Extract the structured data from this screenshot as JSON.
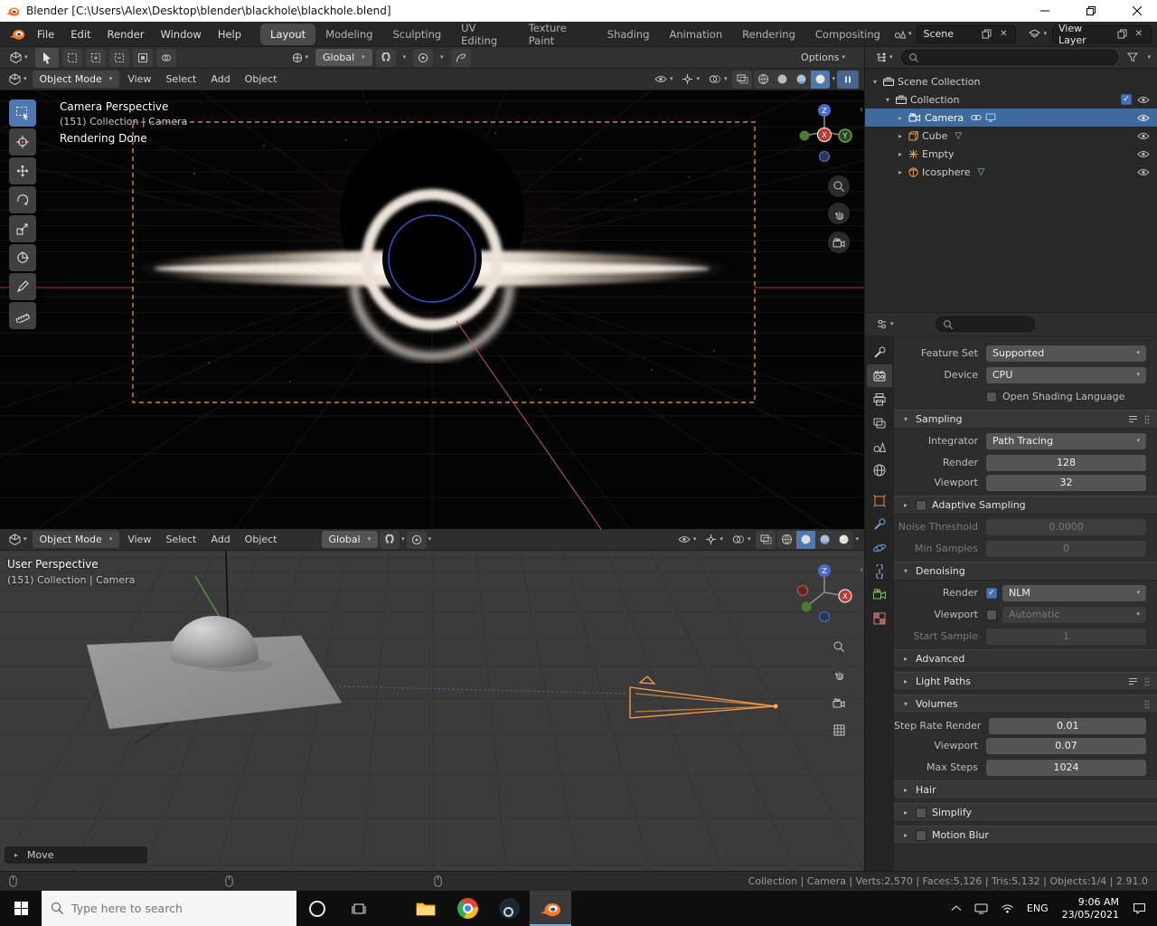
{
  "titlebar": {
    "title": "Blender [C:\\Users\\Alex\\Desktop\\blender\\blackhole\\blackhole.blend]"
  },
  "topbar": {
    "menus": [
      "File",
      "Edit",
      "Render",
      "Window",
      "Help"
    ],
    "workspaces": [
      "Layout",
      "Modeling",
      "Sculpting",
      "UV Editing",
      "Texture Paint",
      "Shading",
      "Animation",
      "Rendering",
      "Compositing"
    ],
    "scene_name": "Scene",
    "view_layer_name": "View Layer"
  },
  "toolrow": {
    "orientation": "Global",
    "options": "Options"
  },
  "viewport_top": {
    "mode": "Object Mode",
    "menus": [
      "View",
      "Select",
      "Add",
      "Object"
    ],
    "overlay_line1": "Camera Perspective",
    "overlay_line2": "(151) Collection | Camera",
    "overlay_line3": "Rendering Done"
  },
  "viewport_bottom": {
    "mode": "Object Mode",
    "menus": [
      "View",
      "Select",
      "Add",
      "Object"
    ],
    "orientation": "Global",
    "overlay_line1": "User Perspective",
    "overlay_line2": "(151) Collection | Camera",
    "move_panel": "Move"
  },
  "gizmo": {
    "x": "X",
    "y": "Y",
    "z": "Z"
  },
  "outliner": {
    "items": [
      {
        "label": "Scene Collection"
      },
      {
        "label": "Collection"
      },
      {
        "label": "Camera"
      },
      {
        "label": "Cube"
      },
      {
        "label": "Empty"
      },
      {
        "label": "Icosphere"
      }
    ]
  },
  "properties": {
    "feature_set_label": "Feature Set",
    "feature_set_value": "Supported",
    "device_label": "Device",
    "device_value": "CPU",
    "osl_label": "Open Shading Language",
    "sampling_title": "Sampling",
    "integrator_label": "Integrator",
    "integrator_value": "Path Tracing",
    "render_label": "Render",
    "render_value": "128",
    "viewport_label": "Viewport",
    "viewport_value": "32",
    "adaptive_title": "Adaptive Sampling",
    "noise_threshold_label": "Noise Threshold",
    "noise_threshold_value": "0.0000",
    "min_samples_label": "Min Samples",
    "min_samples_value": "0",
    "denoising_title": "Denoising",
    "den_render_label": "Render",
    "den_render_value": "NLM",
    "den_viewport_label": "Viewport",
    "den_viewport_value": "Automatic",
    "start_sample_label": "Start Sample",
    "start_sample_value": "1",
    "advanced_title": "Advanced",
    "light_paths_title": "Light Paths",
    "volumes_title": "Volumes",
    "step_rate_label": "Step Rate Render",
    "step_rate_value": "0.01",
    "vol_viewport_label": "Viewport",
    "vol_viewport_value": "0.07",
    "max_steps_label": "Max Steps",
    "max_steps_value": "1024",
    "hair_title": "Hair",
    "simplify_title": "Simplify",
    "motion_blur_title": "Motion Blur"
  },
  "statusbar": {
    "right": "Collection | Camera | Verts:2,570 | Faces:5,126 | Tris:5,132 | Objects:1/4 | 2.91.0"
  },
  "taskbar": {
    "search_placeholder": "Type here to search",
    "lang": "ENG",
    "time": "9:06 AM",
    "date": "23/05/2021"
  },
  "colors": {
    "accent": "#4772b3",
    "blender_orange": "#f5792a",
    "selection_orange": "#ff9d45"
  }
}
